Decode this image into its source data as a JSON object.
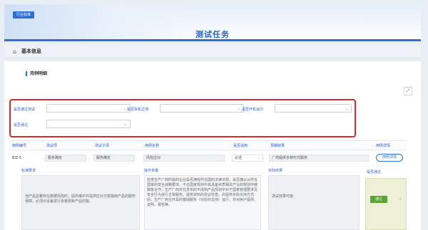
{
  "header": {
    "tag": "行业标准",
    "title": "测试任务"
  },
  "section": {
    "title": "基本信息",
    "icon": "home-icon"
  },
  "panel": {
    "subtitle": "用例明细",
    "expand_icon": "expand-icon"
  },
  "filters": {
    "f1": {
      "label": "是否通过测试:",
      "value": ""
    },
    "f2": {
      "label": "是否拆机过测:",
      "value": ""
    },
    "f3": {
      "label": "是否开机运行:",
      "value": ""
    },
    "f4": {
      "label": "是否通过:",
      "value": ""
    }
  },
  "table": {
    "headers": [
      "用例编号",
      "测试项",
      "测试子项",
      "用例名称",
      "是否适用",
      "预期结果",
      "用例详情"
    ],
    "row": {
      "id": "BIZ-5",
      "item": "服务确定",
      "subitem": "服务确定",
      "name": "风险应对",
      "applicable": "必选",
      "expected": "厂商提供多种形式服务",
      "detail_button": "用例详情"
    }
  },
  "sections": {
    "standard_label": "标准要求",
    "standard_text": "当产品显著存在数据风险时，提供维护并提供应对方案指南产品的服务保障，必须对设备进行安装更新产品的能。",
    "steps_label": "操作步骤",
    "steps_text": "检查生产厂商所属的企业是否拥有所在国的法律法规，是否遵从从所在国家的安全战略要求。不在国家规划中其具备资质相关产业的规划中被赋能合作；生产厂商并在发布的不成熟产品规划中对于国家管理要求及安全行为进行正常服务。提供资料的协议检查。的提供实际支持方式后，生产厂商在开具的基础服务（对应的支持）运行，并对用户提供、证明、报告等。",
    "actual_label": "实际结果",
    "actual_text": "测试效果可能",
    "pass_label": "是否通过",
    "pass_value": "通过"
  },
  "colors": {
    "accent": "#2f6fd3",
    "highlight_border": "#d42a2a",
    "pass_green": "#5aa632"
  }
}
